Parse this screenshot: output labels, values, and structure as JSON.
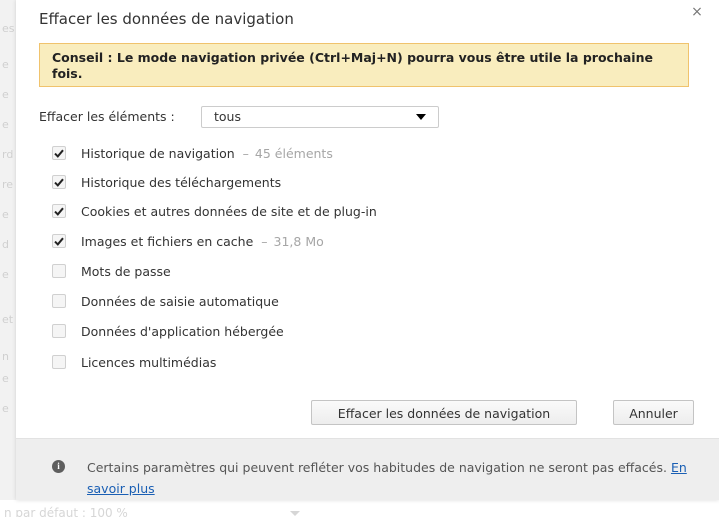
{
  "dialog": {
    "title": "Effacer les données de navigation",
    "close_symbol": "×",
    "tip": "Conseil : Le mode navigation privée (Ctrl+Maj+N) pourra vous être utile la prochaine fois.",
    "range_label": "Effacer les éléments :",
    "range_selected": "tous",
    "items": [
      {
        "label": "Historique de navigation",
        "detail": "45 éléments",
        "checked": true
      },
      {
        "label": "Historique des téléchargements",
        "detail": "",
        "checked": true
      },
      {
        "label": "Cookies et autres données de site et de plug-in",
        "detail": "",
        "checked": true
      },
      {
        "label": "Images et fichiers en cache",
        "detail": "31,8 Mo",
        "checked": true
      },
      {
        "label": "Mots de passe",
        "detail": "",
        "checked": false
      },
      {
        "label": "Données de saisie automatique",
        "detail": "",
        "checked": false
      },
      {
        "label": "Données d'application hébergée",
        "detail": "",
        "checked": false
      },
      {
        "label": "Licences multimédias",
        "detail": "",
        "checked": false
      }
    ],
    "detail_separator": "–",
    "buttons": {
      "clear": "Effacer les données de navigation",
      "cancel": "Annuler"
    },
    "footer": {
      "text": "Certains paramètres qui peuvent refléter vos habitudes de navigation ne seront pas effacés.",
      "link": "En savoir plus",
      "icon": "info-icon"
    }
  },
  "background": {
    "left_fragments": [
      "es",
      "e",
      "e",
      "e",
      "rd",
      "re",
      "e",
      "d",
      "e",
      "et",
      "n",
      "e",
      "e"
    ],
    "bottom_text": "n par défaut : 100 %"
  },
  "colors": {
    "tip_background": "#f9edbe",
    "tip_border": "#f0c36d",
    "link": "#1a5fb4",
    "footer_background": "#eeeeee",
    "muted_text": "#a6a6a6"
  }
}
